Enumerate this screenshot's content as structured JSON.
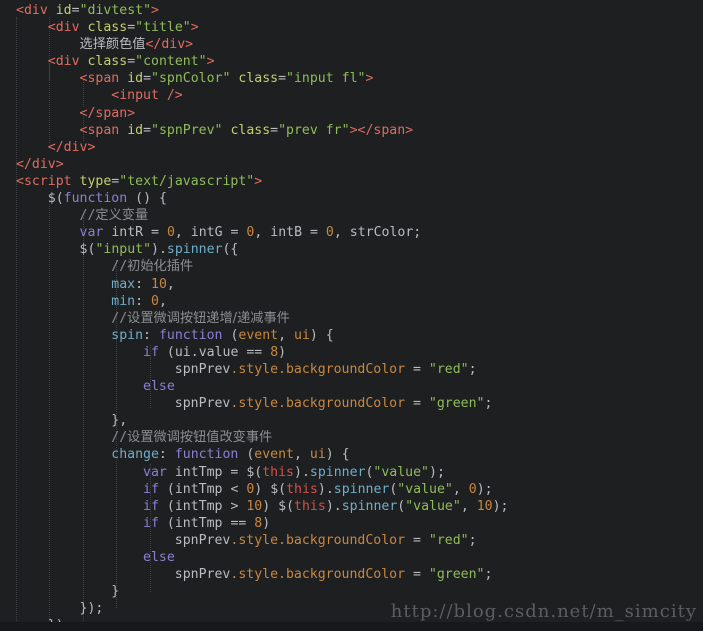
{
  "editor": {
    "background_color": "#1e1f21",
    "default_text_color": "#b9bcc0",
    "indent_guide_color": "#4a4d52",
    "language": "HTML / JavaScript",
    "colors": {
      "tag": "#e06c5f",
      "attribute": "#c5cf6d",
      "string": "#8fbc5a",
      "keyword": "#8b7fd4",
      "function": "#6faec9",
      "property": "#c8873f",
      "number": "#c8873f",
      "parameter": "#c8873f",
      "this": "#d2504a",
      "comment": "#8a8d91"
    }
  },
  "watermark": {
    "text": "http://blog.csdn.net/m_simcity"
  },
  "code": {
    "lines": [
      "<div id=\"divtest\">",
      "    <div class=\"title\">",
      "        选择颜色值</div>",
      "    <div class=\"content\">",
      "        <span id=\"spnColor\" class=\"input fl\">",
      "            <input />",
      "        </span>",
      "        <span id=\"spnPrev\" class=\"prev fr\"></span>",
      "    </div>",
      "</div>",
      "<script type=\"text/javascript\">",
      "    $(function () {",
      "        //定义变量",
      "        var intR = 0, intG = 0, intB = 0, strColor;",
      "        $(\"input\").spinner({",
      "            //初始化插件",
      "            max: 10,",
      "            min: 0,",
      "            //设置微调按钮递增/递减事件",
      "            spin: function (event, ui) {",
      "                if (ui.value == 8)",
      "                    spnPrev.style.backgroundColor = \"red\";",
      "                else",
      "                    spnPrev.style.backgroundColor = \"green\";",
      "            },",
      "            //设置微调按钮值改变事件",
      "            change: function (event, ui) {",
      "                var intTmp = $(this).spinner(\"value\");",
      "                if (intTmp < 0) $(this).spinner(\"value\", 0);",
      "                if (intTmp > 10) $(this).spinner(\"value\", 10);",
      "                if (intTmp == 8)",
      "                    spnPrev.style.backgroundColor = \"red\";",
      "                else",
      "                    spnPrev.style.backgroundColor = \"green\";",
      "            }",
      "        });",
      "    });"
    ]
  }
}
